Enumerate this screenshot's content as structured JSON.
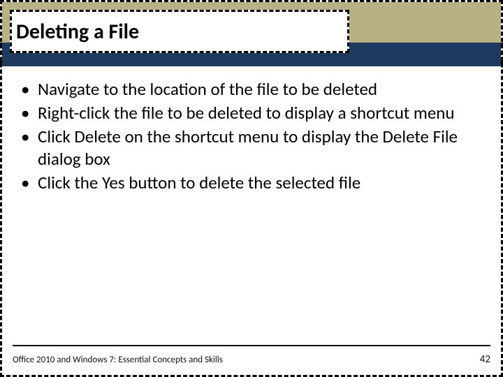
{
  "title": "Deleting a File",
  "bullets": [
    "Navigate to the location of the file to be deleted",
    "Right-click the file to be deleted to display a shortcut menu",
    "Click Delete on the shortcut menu to display the Delete File dialog box",
    "Click the Yes button to delete the selected file"
  ],
  "footer": {
    "text": "Office 2010 and Windows 7: Essential Concepts and Skills",
    "page": "42"
  }
}
